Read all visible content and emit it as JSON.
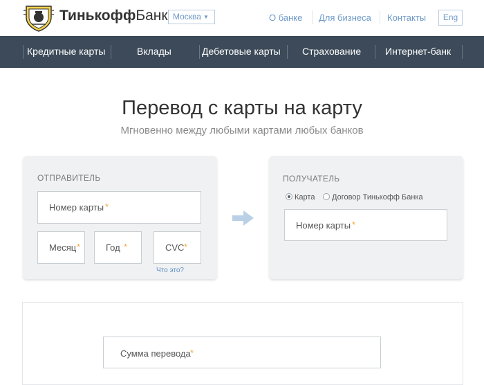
{
  "header": {
    "brand_bold": "Тинькофф",
    "brand_regular": "Банк",
    "city": "Москва",
    "links": [
      "О банке",
      "Для бизнеса",
      "Контакты"
    ],
    "lang": "Eng"
  },
  "nav": {
    "items": [
      "Кредитные карты",
      "Вклады",
      "Дебетовые карты",
      "Страхование",
      "Интернет-банк"
    ]
  },
  "page": {
    "title": "Перевод с карты на карту",
    "subtitle": "Мгновенно между любыми картами любых банков"
  },
  "sender": {
    "label": "ОТПРАВИТЕЛЬ",
    "card_placeholder": "Номер карты",
    "month_placeholder": "Месяц",
    "year_placeholder": "Год",
    "cvc_placeholder": "CVC",
    "cvc_help": "Что это?"
  },
  "receiver": {
    "label": "ПОЛУЧАТЕЛЬ",
    "option_card": "Карта",
    "option_contract": "Договор Тинькофф Банка",
    "selected": "Карта",
    "card_placeholder": "Номер карты"
  },
  "amount": {
    "placeholder": "Сумма перевода"
  },
  "required_mark": "*",
  "colors": {
    "nav_bg": "#3c4a59",
    "link": "#6f9ac8",
    "required": "#f0a83a",
    "panel_bg": "#f0f1f2",
    "arrow": "#b9d0e6"
  },
  "icons": {
    "logo": "shield-crest-logo",
    "city_chevron": "chevron-down-icon",
    "transfer_arrow": "arrow-right-icon"
  }
}
